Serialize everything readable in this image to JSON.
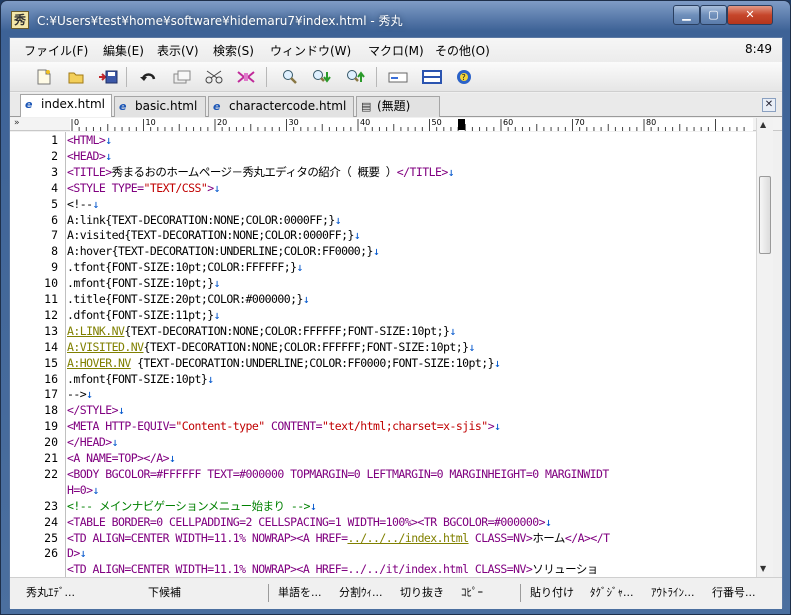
{
  "window": {
    "title": "C:¥Users¥test¥home¥software¥hidemaru7¥index.html - 秀丸",
    "app_icon": "秀"
  },
  "menu": {
    "items": [
      "ファイル(F)",
      "編集(E)",
      "表示(V)",
      "検索(S)",
      "ウィンドウ(W)",
      "マクロ(M)",
      "その他(O)"
    ],
    "clock": "8:49"
  },
  "toolbar": {
    "icons": [
      "new-file-icon",
      "open-folder-icon",
      "save-icon",
      "undo-icon",
      "copy-icon",
      "cut-icon",
      "paste-icon",
      "find-icon",
      "find-down-icon",
      "find-up-icon",
      "replace-icon",
      "split-window-icon",
      "help-icon"
    ]
  },
  "tabs": [
    {
      "label": "index.html",
      "icon": "ie-doc-icon",
      "active": true
    },
    {
      "label": "basic.html",
      "icon": "ie-doc-icon",
      "active": false
    },
    {
      "label": "charactercode.html",
      "icon": "ie-doc-icon",
      "active": false
    },
    {
      "label": "(無題)",
      "icon": "doc-icon",
      "active": false
    }
  ],
  "ruler": {
    "guide": "»",
    "labels": [
      "0",
      "10",
      "20",
      "30",
      "40",
      "50",
      "60",
      "70",
      "80"
    ]
  },
  "editor": {
    "line_numbers": [
      "1",
      "2",
      "3",
      "4",
      "5",
      "6",
      "7",
      "8",
      "9",
      "10",
      "11",
      "12",
      "13",
      "14",
      "15",
      "16",
      "17",
      "18",
      "19",
      "20",
      "21",
      "22",
      "",
      "23",
      "24",
      "25",
      "26",
      "",
      "27"
    ],
    "lines": [
      [
        [
          "tag",
          "<HTML>"
        ],
        [
          "nl",
          "↓"
        ]
      ],
      [
        [
          "tag",
          "<HEAD>"
        ],
        [
          "nl",
          "↓"
        ]
      ],
      [
        [
          "tag",
          "<TITLE>"
        ],
        [
          "txt",
          "秀まるおのホームページ－秀丸エディタの紹介（ 概要 ）"
        ],
        [
          "tag",
          "</TITLE>"
        ],
        [
          "nl",
          "↓"
        ]
      ],
      [
        [
          "tag",
          "<STYLE TYPE="
        ],
        [
          "str",
          "\"TEXT/CSS\""
        ],
        [
          "tag",
          ">"
        ],
        [
          "nl",
          "↓"
        ]
      ],
      [
        [
          "txt",
          "<!--"
        ],
        [
          "nl",
          "↓"
        ]
      ],
      [
        [
          "txt",
          "A:link{TEXT-DECORATION:NONE;COLOR:0000FF;}"
        ],
        [
          "nl",
          "↓"
        ]
      ],
      [
        [
          "txt",
          "A:visited{TEXT-DECORATION:NONE;COLOR:0000FF;}"
        ],
        [
          "nl",
          "↓"
        ]
      ],
      [
        [
          "txt",
          "A:hover{TEXT-DECORATION:UNDERLINE;COLOR:FF0000;}"
        ],
        [
          "nl",
          "↓"
        ]
      ],
      [
        [
          "txt",
          ".tfont{FONT-SIZE:10pt;COLOR:FFFFFF;}"
        ],
        [
          "nl",
          "↓"
        ]
      ],
      [
        [
          "txt",
          ".mfont{FONT-SIZE:10pt;}"
        ],
        [
          "nl",
          "↓"
        ]
      ],
      [
        [
          "txt",
          ".title{FONT-SIZE:20pt;COLOR:#000000;}"
        ],
        [
          "nl",
          "↓"
        ]
      ],
      [
        [
          "txt",
          ".dfont{FONT-SIZE:11pt;}"
        ],
        [
          "nl",
          "↓"
        ]
      ],
      [
        [
          "cls",
          "A:LINK.NV"
        ],
        [
          "txt",
          "{TEXT-DECORATION:NONE;COLOR:FFFFFF;FONT-SIZE:10pt;}"
        ],
        [
          "nl",
          "↓"
        ]
      ],
      [
        [
          "cls",
          "A:VISITED.NV"
        ],
        [
          "txt",
          "{TEXT-DECORATION:NONE;COLOR:FFFFFF;FONT-SIZE:10pt;}"
        ],
        [
          "nl",
          "↓"
        ]
      ],
      [
        [
          "cls",
          "A:HOVER.NV"
        ],
        [
          "txt",
          " {TEXT-DECORATION:UNDERLINE;COLOR:FF0000;FONT-SIZE:10pt;}"
        ],
        [
          "nl",
          "↓"
        ]
      ],
      [
        [
          "txt",
          ".mfont{FONT-SIZE:10pt}"
        ],
        [
          "nl",
          "↓"
        ]
      ],
      [
        [
          "txt",
          "-->"
        ],
        [
          "nl",
          "↓"
        ]
      ],
      [
        [
          "tag",
          "</STYLE>"
        ],
        [
          "nl",
          "↓"
        ]
      ],
      [
        [
          "tag",
          "<META HTTP-EQUIV="
        ],
        [
          "str",
          "\"Content-type\""
        ],
        [
          "tag",
          " CONTENT="
        ],
        [
          "str",
          "\"text/html;charset=x-sjis\""
        ],
        [
          "tag",
          ">"
        ],
        [
          "nl",
          "↓"
        ]
      ],
      [
        [
          "tag",
          "</HEAD>"
        ],
        [
          "nl",
          "↓"
        ]
      ],
      [
        [
          "tag",
          "<A NAME=TOP></A>"
        ],
        [
          "nl",
          "↓"
        ]
      ],
      [
        [
          "tag",
          "<BODY BGCOLOR=#FFFFFF TEXT=#000000 TOPMARGIN=0 LEFTMARGIN=0 MARGINHEIGHT=0 MARGINWIDT"
        ]
      ],
      [
        [
          "tag",
          "H=0>"
        ],
        [
          "nl",
          "↓"
        ]
      ],
      [
        [
          "cmt",
          "<!-- メインナビゲーションメニュー始まり -->"
        ],
        [
          "nl",
          "↓"
        ]
      ],
      [
        [
          "tag",
          "<TABLE BORDER=0 CELLPADDING=2 CELLSPACING=1 WIDTH=100%><TR BGCOLOR=#000000>"
        ],
        [
          "nl",
          "↓"
        ]
      ],
      [
        [
          "tag",
          "<TD ALIGN=CENTER WIDTH=11.1% NOWRAP><A HREF="
        ],
        [
          "lnk",
          "../../../index.html"
        ],
        [
          "tag",
          " CLASS=NV>"
        ],
        [
          "txt",
          "ホーム"
        ],
        [
          "tag",
          "</A></T"
        ]
      ],
      [
        [
          "tag",
          "D>"
        ],
        [
          "nl",
          "↓"
        ]
      ],
      [
        [
          "tag",
          "<TD ALIGN=CENTER WIDTH=11.1% NOWRAP><A HREF=../../it/index.html CLASS=NV>"
        ],
        [
          "txt",
          "ソリューショ"
        ]
      ]
    ]
  },
  "statusbar": {
    "keys": [
      "秀丸ｴﾃﾞ...",
      "",
      "下候補",
      "",
      "単語を...",
      "分割ｳｨ...",
      "切り抜き",
      "ｺﾋﾟｰ",
      "",
      "貼り付け",
      "ﾀｸﾞｼﾞｬ...",
      "ｱｳﾄﾗｲﾝ...",
      "行番号..."
    ]
  }
}
